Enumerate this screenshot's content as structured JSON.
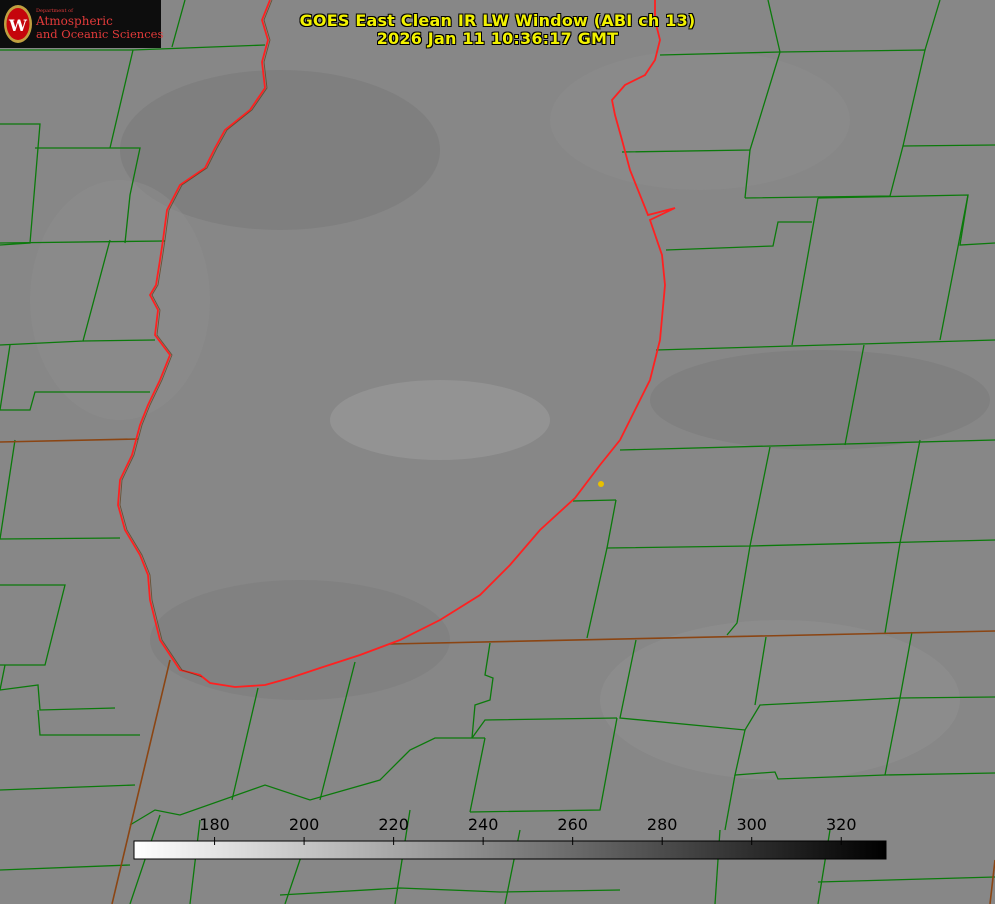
{
  "title": {
    "line1": "GOES East Clean IR LW Window (ABI ch 13)",
    "line2": "2026 Jan 11 10:36:17 GMT"
  },
  "logo": {
    "department": "Department of",
    "name_line1": "Atmospheric",
    "name_line2": "and Oceanic Sciences",
    "seal_letter": "W"
  },
  "colorbar": {
    "label_min": 180,
    "label_max": 320,
    "tick_labels": [
      "180",
      "200",
      "220",
      "240",
      "260",
      "280",
      "300",
      "320"
    ],
    "range": [
      162,
      330
    ],
    "gradient": [
      "#ffffff",
      "#000000"
    ]
  },
  "colors": {
    "background": "#8a8a8a",
    "county_lines": "#0b7a0b",
    "state_lines": "#8b4513",
    "lake_outline": "#ff2020",
    "title_text": "#f2f200",
    "marker": "#e8c000"
  },
  "icons": {
    "seal": "university-seal-icon",
    "marker": "station-marker-icon"
  }
}
